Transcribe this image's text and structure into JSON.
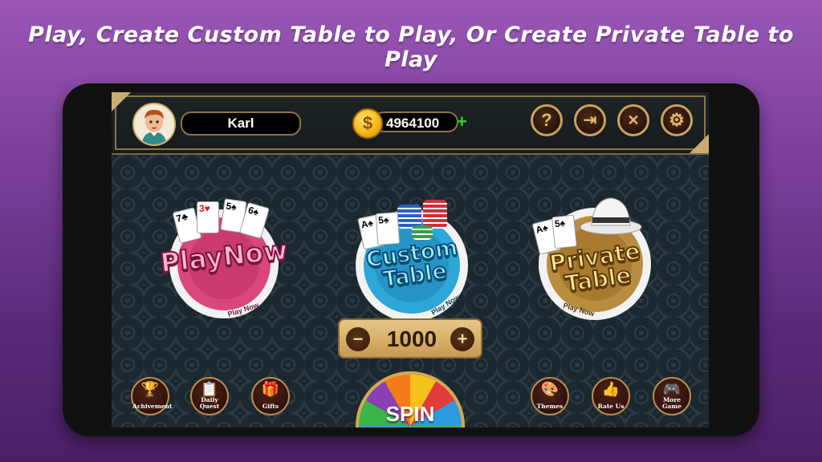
{
  "banner": {
    "text": "Play, Create Custom Table to Play, Or Create Private Table to Play"
  },
  "header": {
    "player_name": "Karl",
    "coin_symbol": "$",
    "coins": "4964100",
    "add_symbol": "+",
    "buttons": [
      {
        "name": "help",
        "glyph": "?"
      },
      {
        "name": "exit",
        "glyph": "⇥"
      },
      {
        "name": "share",
        "glyph": "✕"
      },
      {
        "name": "settings",
        "glyph": "⚙"
      }
    ]
  },
  "modes": [
    {
      "title_line1": "Play",
      "title_line2": "Now",
      "ring_text": "Play Now",
      "color": "#d9477d"
    },
    {
      "title_line1": "Custom",
      "title_line2": "Table",
      "ring_text": "Play Now",
      "color": "#2fa6d8"
    },
    {
      "title_line1": "Private",
      "title_line2": "Table",
      "ring_text": "Play Now",
      "color": "#b98d3e"
    }
  ],
  "bet": {
    "minus": "−",
    "value": "1000",
    "plus": "+"
  },
  "spin": {
    "label": "SPIN"
  },
  "bottom_left": [
    {
      "label": "Achivement",
      "icon": "🏆"
    },
    {
      "label": "Daily Quest",
      "icon": "📋"
    },
    {
      "label": "Gifts",
      "icon": "🎁"
    }
  ],
  "bottom_right": [
    {
      "label": "Themes",
      "icon": "🎨"
    },
    {
      "label": "Rate Us",
      "icon": "👍"
    },
    {
      "label": "More Game",
      "icon": "🎮"
    }
  ],
  "colors": {
    "accent_gold": "#c9ad70",
    "coin_gold": "#f4b818",
    "plus_green": "#2fd12f"
  }
}
